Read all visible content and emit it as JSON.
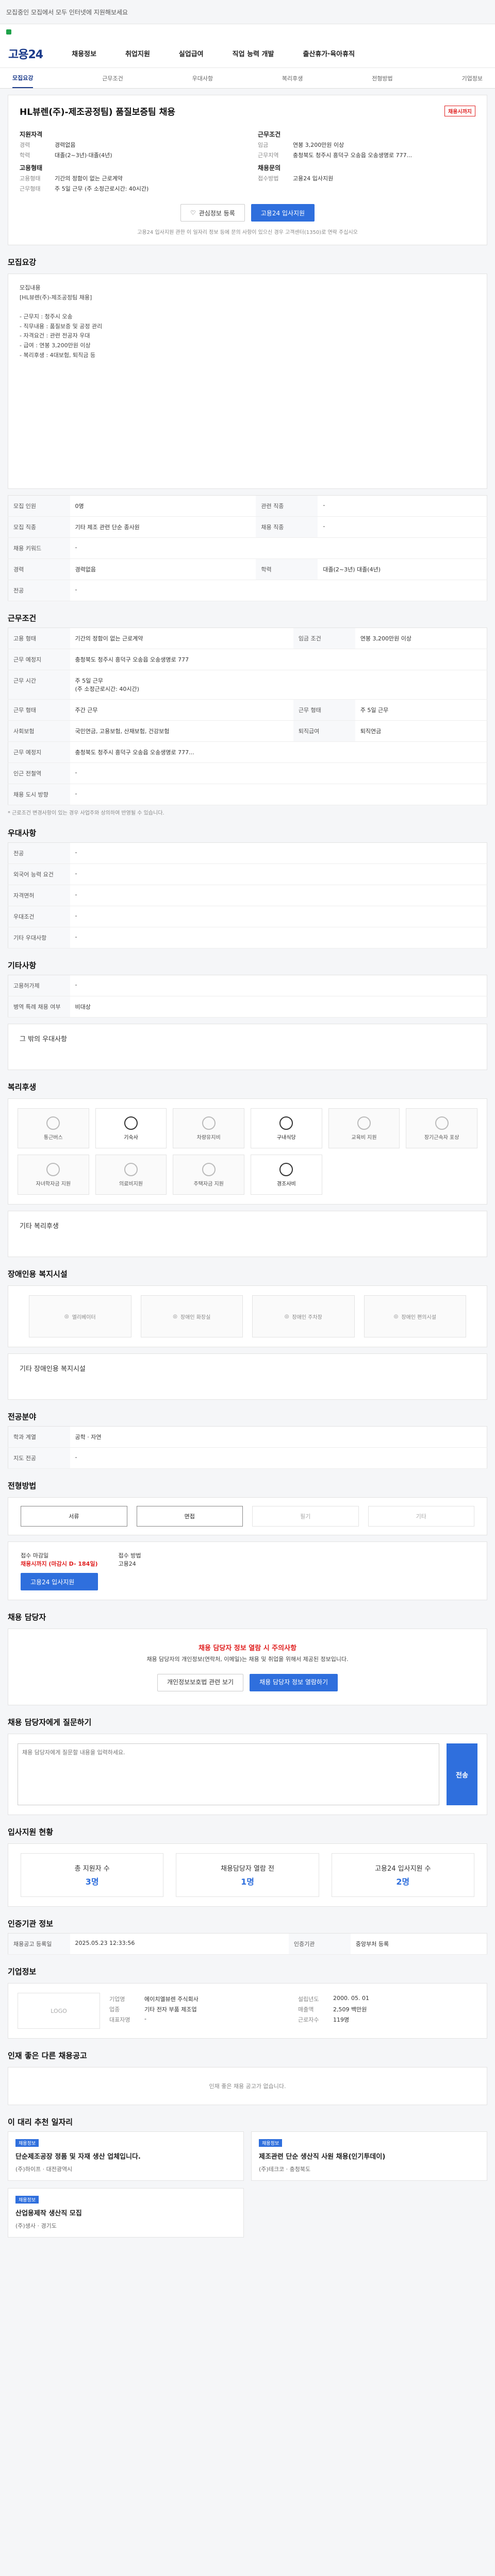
{
  "notice": "모집중인 모집에서 모두 인터넷에 지원해보세요",
  "nav": {
    "logo": "고용24",
    "items": [
      "채용정보",
      "취업지원",
      "실업급여",
      "직업 능력 개발",
      "출산휴가·육아휴직"
    ]
  },
  "tabs": [
    "모집요강",
    "근무조건",
    "우대사항",
    "복리후생",
    "전형방법",
    "기업정보"
  ],
  "job": {
    "title": "HL뷰렌(주)-제조공정팀) 품질보증팀 채용",
    "badge": "채용시까지",
    "left_heading": "지원자격",
    "left": [
      {
        "k": "경력",
        "v": "경력없음"
      },
      {
        "k": "학력",
        "v": "대졸(2~3년)·대졸(4년)"
      }
    ],
    "left2_heading": "고용형태",
    "left2": [
      {
        "k": "고용형태",
        "v": "기간의 정함이 없는 근로계약"
      },
      {
        "k": "근무형태",
        "v": "주 5일 근무 (주 소정근로시간: 40시간)"
      }
    ],
    "right_heading": "근무조건",
    "right": [
      {
        "k": "임금",
        "v": "연봉 3,200만원 이상"
      },
      {
        "k": "근무지역",
        "v": "충청북도 청주시 흥덕구 오송읍 오송생명로 777..."
      }
    ],
    "right2_heading": "채용문의",
    "right2": [
      {
        "k": "접수방법",
        "v": "고용24 입사지원"
      }
    ],
    "btn_fav": "관심정보 등록",
    "btn_apply": "고용24 입사지원",
    "note": "고용24 입사지원 관한 이 일자리 정보 등에 문의 사항이 있으신 경우 고객센터(1350)로 연락 주십시오"
  },
  "section_recruit": "모집요강",
  "desc": "모집내용\n[HL뷰렌(주)-제조공정팀 채용]\n\n- 근무지 : 청주시 오송\n- 직무내용 : 품질보증 및 공정 관리\n- 자격요건 : 관련 전공자 우대\n- 급여 : 연봉 3,200만원 이상\n- 복리후생 : 4대보험, 퇴직금 등",
  "recruit_table": [
    {
      "k": "모집 인원",
      "v": "0명",
      "k2": "관련 직종",
      "v2": "-"
    },
    {
      "k": "모집 직종",
      "v": "기타 제조 관련 단순 종사원",
      "k2": "채용 직종",
      "v2": "-"
    },
    {
      "k": "채용 키워드",
      "v": "-",
      "k2": "",
      "v2": ""
    },
    {
      "k": "경력",
      "v": "경력없음",
      "k2": "학력",
      "v2": "대졸(2~3년) 대졸(4년)"
    },
    {
      "k": "전공",
      "v": "-",
      "k2": "",
      "v2": ""
    }
  ],
  "section_condition": "근무조건",
  "condition_table": [
    {
      "k": "고용 형태",
      "v": "기간의 정함이 없는 근로계약",
      "k2": "임금 조건",
      "v2": "연봉 3,200만원 이상"
    },
    {
      "k": "근무 예정지",
      "v": "충청북도 청주시 흥덕구 오송읍 오송생명로 777",
      "k2": "",
      "v2": ""
    },
    {
      "k": "근무 시간",
      "v": "주 5일 근무\n(주 소정근로시간: 40시간)",
      "k2": "",
      "v2": ""
    },
    {
      "k": "근무 형태",
      "v": "주간 근무",
      "k2": "근무 형태",
      "v2": "주 5일 근무"
    },
    {
      "k": "사회보험",
      "v": "국민연금, 고용보험, 산재보험, 건강보험",
      "k2": "퇴직급여",
      "v2": "퇴직연금"
    },
    {
      "k": "근무 예정지",
      "v": "충청북도 청주시 흥덕구 오송읍 오송생명로 777...",
      "k2": "",
      "v2": ""
    },
    {
      "k": "인근 전철역",
      "v": "-",
      "k2": "",
      "v2": ""
    },
    {
      "k": "채용 도시 방향",
      "v": "-",
      "k2": "",
      "v2": ""
    }
  ],
  "condition_note": "* 근로조건 변경사항이 있는 경우 사업주와 상의하여 반영될 수 있습니다.",
  "section_prefer": "우대사항",
  "prefer_table": [
    {
      "k": "전공",
      "v": "-"
    },
    {
      "k": "외국어 능력 요건",
      "v": "-"
    },
    {
      "k": "자격면허",
      "v": "-"
    },
    {
      "k": "우대조건",
      "v": "-"
    },
    {
      "k": "기타 우대사항",
      "v": "-"
    }
  ],
  "section_other": "기타사항",
  "other_table": [
    {
      "k": "고용허가제",
      "v": "-"
    },
    {
      "k": "병역 특례 채용 여부",
      "v": "비대상"
    }
  ],
  "other_more": "그 밖의 우대사항",
  "section_welfare": "복리후생",
  "welfare": [
    "통근버스",
    "기숙사",
    "차량유지비",
    "구내식당",
    "교육비 지원",
    "장기근속자 포상",
    "자녀학자금 지원",
    "의료비지원",
    "주택자금 지원",
    "경조사비"
  ],
  "welfare_more": "기타 복리후생",
  "section_disabled": "장애인용 복지시설",
  "disabled": [
    "엘리베이터",
    "장애인 화장실",
    "장애인 주차장",
    "장애인 편의시설"
  ],
  "disabled_more": "기타 장애인용 복지시설",
  "section_major": "전공분야",
  "major_table": [
    {
      "k": "학과 계열",
      "v": "공학 · 자연"
    },
    {
      "k": "지도 전공",
      "v": "-"
    }
  ],
  "section_method": "전형방법",
  "methods": [
    "서류",
    "면접",
    "필기",
    "기타"
  ],
  "deadline": {
    "label": "접수 마감일",
    "value": "채용시까지 (마감시 D- 184일)",
    "btn": "고용24 입사지원",
    "label2": "접수 방법",
    "value2": "고용24"
  },
  "section_contact": "채용 담당자",
  "contact_alert": "채용 담당자 정보 열람 시 주의사항",
  "contact_text": "채용 담당자의 개인정보(연락처, 이메일)는 채용 및 취업을 위해서 제공된 정보입니다.",
  "contact_btn1": "개인정보보호법 관련 보기",
  "contact_btn2": "채용 담당자 정보 열람하기",
  "section_qa": "채용 담당자에게 질문하기",
  "qa_placeholder": "채용 담당자에게 질문할 내용을 입력하세요.",
  "qa_send": "전송",
  "section_stats": "입사지원 현황",
  "stats": [
    {
      "k": "총 지원자 수",
      "v": "3명"
    },
    {
      "k": "채용담당자 열람 전",
      "v": "1명"
    },
    {
      "k": "고용24 입사지원 수",
      "v": "2명"
    }
  ],
  "section_info": "인증기관 정보",
  "info_table": [
    {
      "k": "채용공고 등록일",
      "v": "2025.05.23 12:33:56"
    },
    {
      "k": "인증기관",
      "v": "중앙부처 등록"
    }
  ],
  "section_company": "기업정보",
  "company": {
    "logo": "LOGO",
    "rows": [
      {
        "k": "기업명",
        "v": "에이치엘뷰렌 주식회사"
      },
      {
        "k": "업종",
        "v": "기타 전자 부품 제조업"
      },
      {
        "k": "대표자명",
        "v": "-"
      }
    ],
    "rows2": [
      {
        "k": "설립년도",
        "v": "2000. 05. 01"
      },
      {
        "k": "매출액",
        "v": "2,509 백만원"
      },
      {
        "k": "근로자수",
        "v": "119명"
      }
    ]
  },
  "section_other_jobs": "인재 좋은 다른 채용공고",
  "empty_text": "인재 좋은 채용 공고가 없습니다.",
  "section_recommend": "이 대리 추천 일자리",
  "recommend": [
    {
      "tag": "채용정보",
      "title": "단순제조공장 정품 및 자재 생산 업체입니다.",
      "company": "(주)하이프",
      "loc": "대전광역시"
    },
    {
      "tag": "채용정보",
      "title": "제조관련 단순 생산직 사원 채용(인기투데이)",
      "company": "(주)테크코",
      "loc": "충청북도"
    },
    {
      "tag": "채용정보",
      "title": "산업용제작 생산직 모집",
      "company": "(주)생사",
      "loc": "경기도"
    }
  ]
}
